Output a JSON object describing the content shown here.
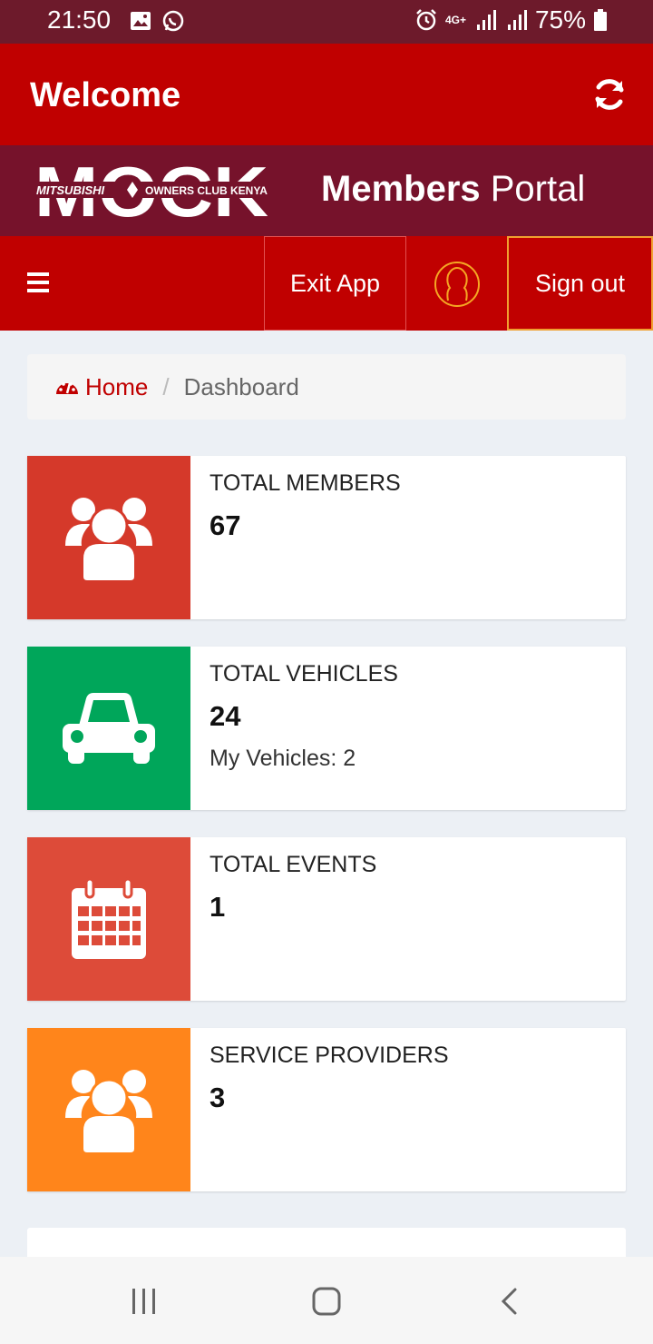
{
  "status_bar": {
    "time": "21:50",
    "network": "4G+",
    "battery": "75%"
  },
  "header": {
    "title": "Welcome",
    "refresh_icon": "refresh-icon"
  },
  "brand": {
    "logo_text": "MOCK",
    "logo_tagline_left": "MITSUBISHI",
    "logo_tagline_right": "OWNERS CLUB KENYA",
    "portal_bold": "Members",
    "portal_light": "Portal"
  },
  "nav": {
    "exit_label": "Exit App",
    "signout_label": "Sign out"
  },
  "breadcrumb": {
    "home": "Home",
    "separator": "/",
    "current": "Dashboard"
  },
  "cards": [
    {
      "label": "TOTAL MEMBERS",
      "value": "67",
      "extra": "",
      "color": "#d5392a",
      "icon": "users-icon"
    },
    {
      "label": "TOTAL VEHICLES",
      "value": "24",
      "extra": "My Vehicles: 2",
      "color": "#00a65a",
      "icon": "car-icon"
    },
    {
      "label": "TOTAL EVENTS",
      "value": "1",
      "extra": "",
      "color": "#dd4b39",
      "icon": "calendar-icon"
    },
    {
      "label": "SERVICE PROVIDERS",
      "value": "3",
      "extra": "",
      "color": "#ff851b",
      "icon": "users-icon"
    }
  ],
  "colors": {
    "status_bar": "#6d1a2b",
    "header": "#c00000",
    "brand_bar": "#76122b",
    "background": "#ecf0f5"
  }
}
